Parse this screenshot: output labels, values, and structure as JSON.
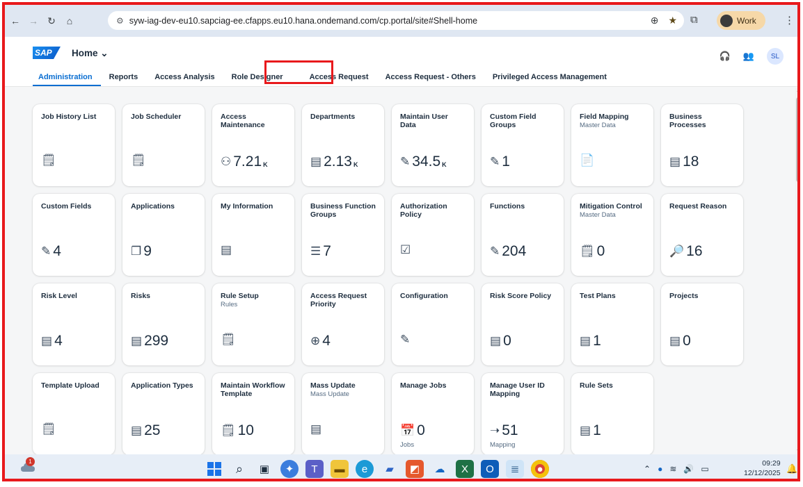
{
  "browser": {
    "url": "syw-iag-dev-eu10.sapciag-ee.cfapps.eu10.hana.ondemand.com/cp.portal/site#Shell-home",
    "profile_label": "Work"
  },
  "shell": {
    "logo_text": "SAP",
    "home_label": "Home ⌄",
    "avatar_initials": "SL"
  },
  "tabs": [
    {
      "label": "Administration"
    },
    {
      "label": "Reports"
    },
    {
      "label": "Access Analysis"
    },
    {
      "label": "Role Designer"
    },
    {
      "label": "Access Request"
    },
    {
      "label": "Access Request - Others"
    },
    {
      "label": "Privileged Access Management"
    }
  ],
  "tiles": [
    {
      "title": "Job History List",
      "subtitle": "",
      "icon": "clipboard-icon",
      "glyph": "🗒",
      "value": "",
      "unit": "",
      "footer": ""
    },
    {
      "title": "Job Scheduler",
      "subtitle": "",
      "icon": "clipboard-icon",
      "glyph": "🗒",
      "value": "",
      "unit": "",
      "footer": ""
    },
    {
      "title": "Access Maintenance",
      "subtitle": "",
      "icon": "user-settings-icon",
      "glyph": "⚇",
      "value": "7.21",
      "unit": "K",
      "footer": ""
    },
    {
      "title": "Departments",
      "subtitle": "",
      "icon": "list-icon",
      "glyph": "▤",
      "value": "2.13",
      "unit": "K",
      "footer": ""
    },
    {
      "title": "Maintain User Data",
      "subtitle": "",
      "icon": "edit-icon",
      "glyph": "✎",
      "value": "34.5",
      "unit": "K",
      "footer": ""
    },
    {
      "title": "Custom Field Groups",
      "subtitle": "",
      "icon": "edit-icon",
      "glyph": "✎",
      "value": "1",
      "unit": "",
      "footer": ""
    },
    {
      "title": "Field Mapping",
      "subtitle": "Master Data",
      "icon": "document-icon",
      "glyph": "📄",
      "value": "",
      "unit": "",
      "footer": ""
    },
    {
      "title": "Business Processes",
      "subtitle": "",
      "icon": "list-icon",
      "glyph": "▤",
      "value": "18",
      "unit": "",
      "footer": ""
    },
    {
      "title": "Custom Fields",
      "subtitle": "",
      "icon": "edit-icon",
      "glyph": "✎",
      "value": "4",
      "unit": "",
      "footer": ""
    },
    {
      "title": "Applications",
      "subtitle": "",
      "icon": "applications-icon",
      "glyph": "❐",
      "value": "9",
      "unit": "",
      "footer": ""
    },
    {
      "title": "My Information",
      "subtitle": "",
      "icon": "list-icon",
      "glyph": "▤",
      "value": "",
      "unit": "",
      "footer": ""
    },
    {
      "title": "Business Function Groups",
      "subtitle": "",
      "icon": "bullet-list-icon",
      "glyph": "☰",
      "value": "7",
      "unit": "",
      "footer": ""
    },
    {
      "title": "Authorization Policy",
      "subtitle": "",
      "icon": "checklist-icon",
      "glyph": "☑",
      "value": "",
      "unit": "",
      "footer": ""
    },
    {
      "title": "Functions",
      "subtitle": "",
      "icon": "edit-icon",
      "glyph": "✎",
      "value": "204",
      "unit": "",
      "footer": ""
    },
    {
      "title": "Mitigation Control",
      "subtitle": "Master Data",
      "icon": "clipboard-icon",
      "glyph": "🗒",
      "value": "0",
      "unit": "",
      "footer": ""
    },
    {
      "title": "Request Reason",
      "subtitle": "",
      "icon": "document-search-icon",
      "glyph": "🔎",
      "value": "16",
      "unit": "",
      "footer": ""
    },
    {
      "title": "Risk Level",
      "subtitle": "",
      "icon": "list-icon",
      "glyph": "▤",
      "value": "4",
      "unit": "",
      "footer": ""
    },
    {
      "title": "Risks",
      "subtitle": "",
      "icon": "list-icon",
      "glyph": "▤",
      "value": "299",
      "unit": "",
      "footer": ""
    },
    {
      "title": "Rule Setup",
      "subtitle": "Rules",
      "icon": "clipboard-icon",
      "glyph": "🗒",
      "value": "",
      "unit": "",
      "footer": ""
    },
    {
      "title": "Access Request Priority",
      "subtitle": "",
      "icon": "search-icon",
      "glyph": "⊕",
      "value": "4",
      "unit": "",
      "footer": ""
    },
    {
      "title": "Configuration",
      "subtitle": "",
      "icon": "edit-icon",
      "glyph": "✎",
      "value": "",
      "unit": "",
      "footer": ""
    },
    {
      "title": "Risk Score Policy",
      "subtitle": "",
      "icon": "list-icon",
      "glyph": "▤",
      "value": "0",
      "unit": "",
      "footer": ""
    },
    {
      "title": "Test Plans",
      "subtitle": "",
      "icon": "list-icon",
      "glyph": "▤",
      "value": "1",
      "unit": "",
      "footer": ""
    },
    {
      "title": "Projects",
      "subtitle": "",
      "icon": "list-icon",
      "glyph": "▤",
      "value": "0",
      "unit": "",
      "footer": ""
    },
    {
      "title": "Template Upload",
      "subtitle": "",
      "icon": "clipboard-icon",
      "glyph": "🗒",
      "value": "",
      "unit": "",
      "footer": ""
    },
    {
      "title": "Application Types",
      "subtitle": "",
      "icon": "list-icon",
      "glyph": "▤",
      "value": "25",
      "unit": "",
      "footer": ""
    },
    {
      "title": "Maintain Workflow Template",
      "subtitle": "",
      "icon": "clipboard-icon",
      "glyph": "🗒",
      "value": "10",
      "unit": "",
      "footer": ""
    },
    {
      "title": "Mass Update",
      "subtitle": "Mass Update",
      "icon": "list-icon",
      "glyph": "▤",
      "value": "",
      "unit": "",
      "footer": ""
    },
    {
      "title": "Manage Jobs",
      "subtitle": "",
      "icon": "calendar-icon",
      "glyph": "📅",
      "value": "0",
      "unit": "",
      "footer": "Jobs"
    },
    {
      "title": "Manage User ID Mapping",
      "subtitle": "",
      "icon": "mapping-arrow-icon",
      "glyph": "➝",
      "value": "51",
      "unit": "",
      "footer": "Mapping"
    },
    {
      "title": "Rule Sets",
      "subtitle": "",
      "icon": "list-icon",
      "glyph": "▤",
      "value": "1",
      "unit": "",
      "footer": ""
    }
  ],
  "taskbar": {
    "weather_badge": "1",
    "clock_time": "09:29",
    "clock_date": "12/12/2025"
  },
  "colors": {
    "highlight": "#e8191c",
    "accent": "#0a6ed1"
  }
}
